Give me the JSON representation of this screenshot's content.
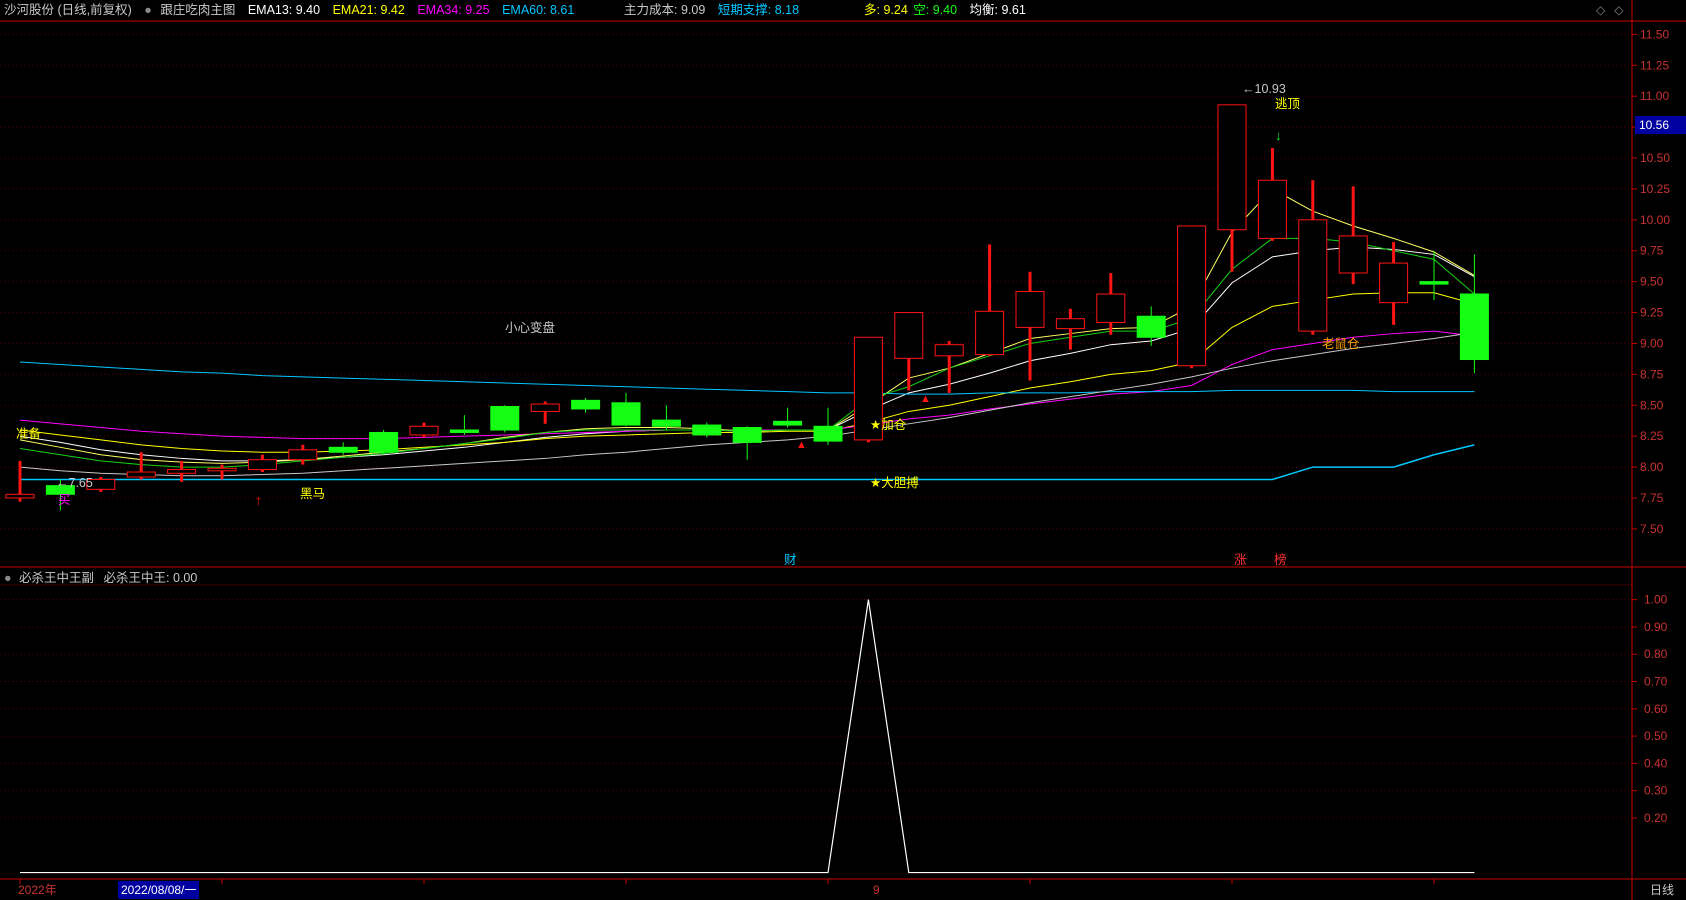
{
  "main_header": {
    "stock_name": "沙河股份 (日线,前复权)",
    "indicator_name": "跟庄吃肉主图",
    "ema13": "EMA13: 9.40",
    "ema21": "EMA21: 9.42",
    "ema34": "EMA34: 9.25",
    "ema60": "EMA60: 8.61",
    "main_cost": "主力成本: 9.09",
    "short_support": "短期支撑: 8.18",
    "long_label": "多: 9.24",
    "short_label": "空: 9.40",
    "balance": "均衡: 9.61"
  },
  "sub_header": {
    "indicator_name": "必杀王中王副",
    "value": "必杀王中王: 0.00"
  },
  "current_price_tag": "10.56",
  "bottom_bar": {
    "year": "2022年",
    "date": "2022/08/08/一",
    "marker": "9",
    "period": "日线"
  },
  "colors": {
    "up": "#ff1414",
    "down": "#14ff14",
    "ema13": "#ffff00",
    "ema21": "#ff00ff",
    "ema34": "#ff50ff",
    "ema60": "#00c8ff",
    "axis": "#c80000"
  },
  "chart_data": [
    {
      "type": "candlestick",
      "title": "沙河股份 (日线,前复权)",
      "y_ticks": [
        "11.50",
        "11.25",
        "11.00",
        "10.75",
        "10.50",
        "10.25",
        "10.00",
        "9.75",
        "9.50",
        "9.25",
        "9.00",
        "8.75",
        "8.50",
        "8.25",
        "8.00",
        "7.75",
        "7.50"
      ],
      "ylim": [
        7.2,
        11.6
      ],
      "candles": [
        {
          "o": 7.75,
          "c": 7.78,
          "h": 8.05,
          "l": 7.72
        },
        {
          "o": 7.85,
          "c": 7.78,
          "h": 7.9,
          "l": 7.65
        },
        {
          "o": 7.82,
          "c": 7.9,
          "h": 7.92,
          "l": 7.8
        },
        {
          "o": 7.92,
          "c": 7.96,
          "h": 8.12,
          "l": 7.9
        },
        {
          "o": 7.95,
          "c": 7.98,
          "h": 8.05,
          "l": 7.88
        },
        {
          "o": 7.97,
          "c": 7.99,
          "h": 8.02,
          "l": 7.9
        },
        {
          "o": 7.98,
          "c": 8.06,
          "h": 8.1,
          "l": 7.96
        },
        {
          "o": 8.06,
          "c": 8.14,
          "h": 8.18,
          "l": 8.02
        },
        {
          "o": 8.16,
          "c": 8.12,
          "h": 8.2,
          "l": 8.1
        },
        {
          "o": 8.28,
          "c": 8.12,
          "h": 8.3,
          "l": 8.1
        },
        {
          "o": 8.26,
          "c": 8.33,
          "h": 8.36,
          "l": 8.24
        },
        {
          "o": 8.3,
          "c": 8.28,
          "h": 8.42,
          "l": 8.26
        },
        {
          "o": 8.49,
          "c": 8.3,
          "h": 8.5,
          "l": 8.28
        },
        {
          "o": 8.45,
          "c": 8.51,
          "h": 8.53,
          "l": 8.35
        },
        {
          "o": 8.54,
          "c": 8.47,
          "h": 8.56,
          "l": 8.44
        },
        {
          "o": 8.52,
          "c": 8.34,
          "h": 8.6,
          "l": 8.33
        },
        {
          "o": 8.38,
          "c": 8.33,
          "h": 8.5,
          "l": 8.3
        },
        {
          "o": 8.34,
          "c": 8.26,
          "h": 8.36,
          "l": 8.24
        },
        {
          "o": 8.32,
          "c": 8.2,
          "h": 8.33,
          "l": 8.06
        },
        {
          "o": 8.37,
          "c": 8.34,
          "h": 8.48,
          "l": 8.32
        },
        {
          "o": 8.33,
          "c": 8.21,
          "h": 8.48,
          "l": 8.18
        },
        {
          "o": 8.22,
          "c": 9.05,
          "h": 9.05,
          "l": 8.2
        },
        {
          "o": 8.88,
          "c": 9.25,
          "h": 9.25,
          "l": 8.62
        },
        {
          "o": 8.9,
          "c": 8.99,
          "h": 9.02,
          "l": 8.6
        },
        {
          "o": 8.91,
          "c": 9.26,
          "h": 9.8,
          "l": 8.9
        },
        {
          "o": 9.13,
          "c": 9.42,
          "h": 9.58,
          "l": 8.7
        },
        {
          "o": 9.12,
          "c": 9.2,
          "h": 9.28,
          "l": 8.95
        },
        {
          "o": 9.17,
          "c": 9.4,
          "h": 9.57,
          "l": 9.07
        },
        {
          "o": 9.22,
          "c": 9.05,
          "h": 9.3,
          "l": 8.98
        },
        {
          "o": 8.82,
          "c": 9.95,
          "h": 9.95,
          "l": 8.8
        },
        {
          "o": 9.92,
          "c": 10.93,
          "h": 10.93,
          "l": 9.58
        },
        {
          "o": 9.85,
          "c": 10.32,
          "h": 10.58,
          "l": 9.83
        },
        {
          "o": 9.1,
          "c": 10.0,
          "h": 10.32,
          "l": 9.07
        },
        {
          "o": 9.57,
          "c": 9.87,
          "h": 10.27,
          "l": 9.48
        },
        {
          "o": 9.33,
          "c": 9.65,
          "h": 9.82,
          "l": 9.15
        },
        {
          "o": 9.5,
          "c": 9.48,
          "h": 9.75,
          "l": 9.35
        },
        {
          "o": 9.4,
          "c": 8.87,
          "h": 9.72,
          "l": 8.76
        }
      ],
      "series": [
        {
          "name": "EMA13",
          "values": [
            8.25,
            8.2,
            8.14,
            8.1,
            8.07,
            8.05,
            8.05,
            8.06,
            8.08,
            8.1,
            8.13,
            8.16,
            8.2,
            8.24,
            8.27,
            8.29,
            8.3,
            8.3,
            8.29,
            8.3,
            8.3,
            8.46,
            8.6,
            8.67,
            8.76,
            8.86,
            8.92,
            8.99,
            9.02,
            9.12,
            9.49,
            9.7,
            9.75,
            9.78,
            9.76,
            9.72,
            9.54
          ]
        },
        {
          "name": "EMA21",
          "values": [
            8.3,
            8.26,
            8.22,
            8.18,
            8.15,
            8.13,
            8.12,
            8.12,
            8.13,
            8.14,
            8.16,
            8.18,
            8.2,
            8.23,
            8.25,
            8.26,
            8.27,
            8.28,
            8.28,
            8.29,
            8.29,
            8.36,
            8.45,
            8.5,
            8.57,
            8.64,
            8.69,
            8.75,
            8.78,
            8.85,
            9.13,
            9.3,
            9.35,
            9.4,
            9.41,
            9.41,
            9.32
          ]
        },
        {
          "name": "EMA34",
          "values": [
            8.38,
            8.35,
            8.32,
            8.29,
            8.27,
            8.25,
            8.24,
            8.23,
            8.23,
            8.23,
            8.24,
            8.25,
            8.26,
            8.27,
            8.28,
            8.29,
            8.3,
            8.3,
            8.3,
            8.3,
            8.3,
            8.34,
            8.39,
            8.42,
            8.47,
            8.51,
            8.55,
            8.59,
            8.61,
            8.66,
            8.83,
            8.95,
            9.0,
            9.05,
            9.08,
            9.1,
            9.06
          ]
        },
        {
          "name": "EMA60",
          "values": [
            8.85,
            8.83,
            8.81,
            8.79,
            8.77,
            8.76,
            8.74,
            8.73,
            8.72,
            8.71,
            8.7,
            8.69,
            8.68,
            8.67,
            8.66,
            8.65,
            8.64,
            8.63,
            8.62,
            8.61,
            8.6,
            8.6,
            8.59,
            8.59,
            8.6,
            8.6,
            8.6,
            8.61,
            8.61,
            8.61,
            8.62,
            8.62,
            8.62,
            8.62,
            8.61,
            8.61,
            8.61
          ]
        },
        {
          "name": "主力成本",
          "values": [
            8.0,
            7.97,
            7.95,
            7.94,
            7.93,
            7.93,
            7.94,
            7.95,
            7.97,
            7.99,
            8.01,
            8.03,
            8.05,
            8.07,
            8.1,
            8.12,
            8.15,
            8.18,
            8.2,
            8.22,
            8.25,
            8.3,
            8.35,
            8.4,
            8.46,
            8.52,
            8.57,
            8.62,
            8.67,
            8.73,
            8.8,
            8.86,
            8.91,
            8.96,
            9.0,
            9.04,
            9.09
          ]
        },
        {
          "name": "短期支撑",
          "values": [
            7.9,
            7.9,
            7.9,
            7.9,
            7.9,
            7.9,
            7.9,
            7.9,
            7.9,
            7.9,
            7.9,
            7.9,
            7.9,
            7.9,
            7.9,
            7.9,
            7.9,
            7.9,
            7.9,
            7.9,
            7.9,
            7.9,
            7.9,
            7.9,
            7.9,
            7.9,
            7.9,
            7.9,
            7.9,
            7.9,
            7.9,
            7.9,
            8.0,
            8.0,
            8.0,
            8.1,
            8.18
          ]
        },
        {
          "name": "均衡",
          "values": [
            8.22,
            8.16,
            8.1,
            8.06,
            8.04,
            8.03,
            8.04,
            8.06,
            8.09,
            8.12,
            8.15,
            8.19,
            8.24,
            8.28,
            8.31,
            8.32,
            8.32,
            8.31,
            8.29,
            8.3,
            8.3,
            8.5,
            8.72,
            8.8,
            8.92,
            9.04,
            9.08,
            9.12,
            9.13,
            9.3,
            9.9,
            10.25,
            10.07,
            9.95,
            9.85,
            9.74,
            9.55
          ]
        },
        {
          "name": "多",
          "values": [
            8.15,
            8.1,
            8.05,
            8.02,
            8.0,
            8.0,
            8.02,
            8.05,
            8.08,
            8.11,
            8.15,
            8.19,
            8.23,
            8.28,
            8.3,
            8.3,
            8.3,
            8.3,
            8.29,
            8.3,
            8.3,
            8.55,
            8.65,
            8.8,
            8.9,
            9.0,
            9.05,
            9.1,
            9.1,
            9.2,
            9.6,
            9.85,
            9.85,
            9.82,
            9.75,
            9.68,
            9.4
          ]
        }
      ],
      "annotations": [
        "准备",
        "←7.65",
        "买",
        "黑马",
        "小心变盘",
        "★加仓",
        "★大胆搏",
        "←10.93",
        "逃顶",
        "老鼠仓",
        "财",
        "涨",
        "榜"
      ]
    },
    {
      "type": "line",
      "title": "必杀王中王副",
      "y_ticks": [
        "1.00",
        "0.90",
        "0.80",
        "0.70",
        "0.60",
        "0.50",
        "0.40",
        "0.30",
        "0.20"
      ],
      "ylim": [
        -0.02,
        1.05
      ],
      "series": [
        {
          "name": "必杀王中王",
          "values": [
            0,
            0,
            0,
            0,
            0,
            0,
            0,
            0,
            0,
            0,
            0,
            0,
            0,
            0,
            0,
            0,
            0,
            0,
            0,
            0,
            0,
            1,
            0,
            0,
            0,
            0,
            0,
            0,
            0,
            0,
            0,
            0,
            0,
            0,
            0,
            0,
            0
          ]
        }
      ]
    }
  ]
}
